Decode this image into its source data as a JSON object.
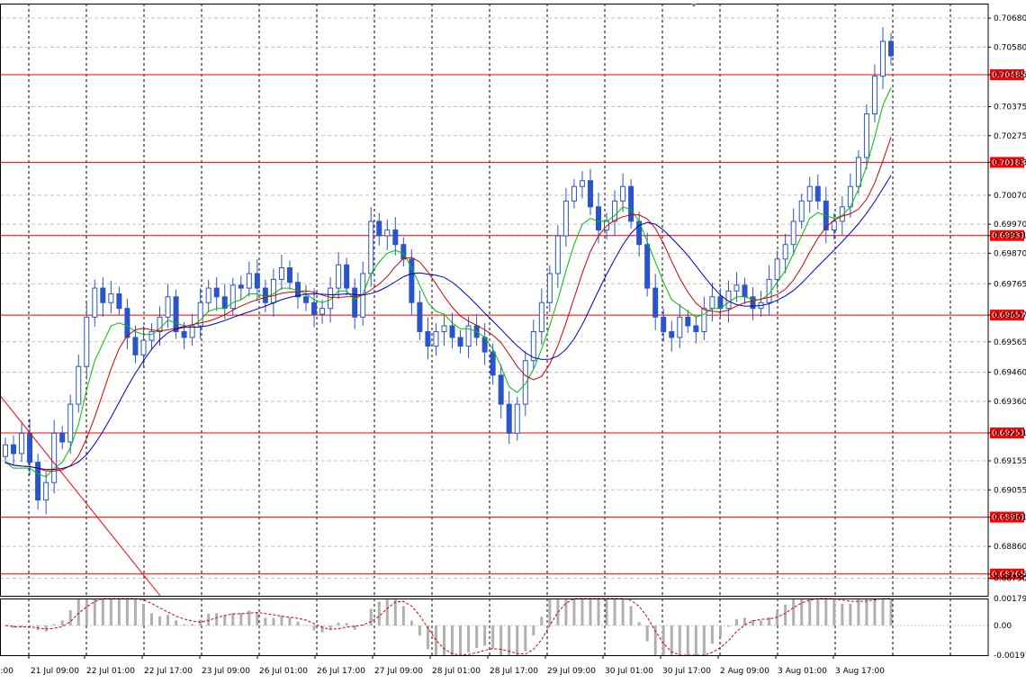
{
  "colors": {
    "background": "#ffffff",
    "grid": "#c0c0c0",
    "candle": "#2a55c8",
    "ma_fast": "#00c000",
    "ma_mid": "#d00000",
    "ma_slow": "#0000c0",
    "hline": "#ff0000",
    "label_bg": "#ff0000",
    "label_text": "#ffffff",
    "osc_hist": "#b0b0b0",
    "osc_signal": "#d00000"
  },
  "chart_data": [
    {
      "type": "candlestick",
      "ylim": [
        0.6869,
        0.7073
      ],
      "price_ticks": [
        "0.70680",
        "0.70580",
        "0.70485",
        "0.70375",
        "0.70275",
        "0.70183",
        "0.70070",
        "0.69970",
        "0.69931",
        "0.69870",
        "0.69765",
        "0.69657",
        "0.69565",
        "0.69460",
        "0.69360",
        "0.69251",
        "0.69155",
        "0.69055",
        "0.68961",
        "0.68860",
        "0.68765",
        "0.68750"
      ],
      "x_labels": [
        "21 Jul 09:00",
        "22 Jul 01:00",
        "22 Jul 17:00",
        "23 Jul 09:00",
        "26 Jul 01:00",
        "26 Jul 17:00",
        "27 Jul 09:00",
        "28 Jul 01:00",
        "28 Jul 17:00",
        "29 Jul 09:00",
        "30 Jul 01:00",
        "30 Jul 17:00",
        "2 Aug 09:00",
        "3 Aug 01:00",
        "3 Aug 17:00"
      ],
      "x_label_left_partial": "l:00",
      "horizontal_levels": [
        "0.70485",
        "0.70183",
        "0.69931",
        "0.69657",
        "0.69251",
        "0.68961",
        "0.68765"
      ],
      "close_series": [
        0.6921,
        0.6918,
        0.6925,
        0.6915,
        0.6902,
        0.6908,
        0.6925,
        0.6922,
        0.6935,
        0.6948,
        0.6965,
        0.6975,
        0.697,
        0.6973,
        0.6968,
        0.6958,
        0.6952,
        0.6957,
        0.696,
        0.6965,
        0.6972,
        0.696,
        0.6958,
        0.6962,
        0.697,
        0.6975,
        0.6972,
        0.6968,
        0.6976,
        0.6975,
        0.698,
        0.6975,
        0.697,
        0.6978,
        0.6982,
        0.6977,
        0.6972,
        0.697,
        0.6966,
        0.6968,
        0.6975,
        0.6983,
        0.6975,
        0.6965,
        0.698,
        0.6998,
        0.6993,
        0.6995,
        0.699,
        0.6985,
        0.697,
        0.696,
        0.6955,
        0.696,
        0.6962,
        0.6958,
        0.6955,
        0.6962,
        0.6958,
        0.6953,
        0.6945,
        0.6935,
        0.6925,
        0.6935,
        0.695,
        0.696,
        0.697,
        0.698,
        0.6993,
        0.7005,
        0.701,
        0.7012,
        0.7003,
        0.6995,
        0.6998,
        0.7005,
        0.701,
        0.6998,
        0.699,
        0.6975,
        0.6965,
        0.696,
        0.6958,
        0.6965,
        0.6962,
        0.696,
        0.6968,
        0.6972,
        0.6968,
        0.6974,
        0.6976,
        0.6972,
        0.6968,
        0.697,
        0.6978,
        0.6985,
        0.699,
        0.6998,
        0.7005,
        0.701,
        0.7005,
        0.6995,
        0.6998,
        0.7003,
        0.701,
        0.702,
        0.7035,
        0.7048,
        0.706,
        0.7055
      ],
      "ma_fast_values": [
        0.6915,
        0.6913,
        0.6913,
        0.6913,
        0.6911,
        0.691,
        0.6913,
        0.6915,
        0.692,
        0.6928,
        0.694,
        0.695,
        0.6956,
        0.6962,
        0.6963,
        0.6962,
        0.696,
        0.6959,
        0.6959,
        0.6961,
        0.6964,
        0.6963,
        0.6962,
        0.6962,
        0.6964,
        0.6967,
        0.6968,
        0.6968,
        0.697,
        0.6971,
        0.6973,
        0.6973,
        0.6972,
        0.6973,
        0.6975,
        0.6975,
        0.6974,
        0.6973,
        0.6971,
        0.697,
        0.6971,
        0.6974,
        0.6974,
        0.6971,
        0.6973,
        0.698,
        0.6984,
        0.6987,
        0.6988,
        0.6987,
        0.6982,
        0.6976,
        0.697,
        0.6967,
        0.6966,
        0.6963,
        0.6961,
        0.6961,
        0.696,
        0.6958,
        0.6954,
        0.6948,
        0.6941,
        0.6939,
        0.6942,
        0.6947,
        0.6954,
        0.6962,
        0.6971,
        0.6981,
        0.699,
        0.6997,
        0.6999,
        0.6998,
        0.6998,
        0.7,
        0.7003,
        0.7002,
        0.6998,
        0.6991,
        0.6984,
        0.6977,
        0.6971,
        0.6969,
        0.6967,
        0.6965,
        0.6966,
        0.6968,
        0.6968,
        0.697,
        0.6972,
        0.6972,
        0.6971,
        0.6971,
        0.6973,
        0.6977,
        0.6981,
        0.6987,
        0.6993,
        0.6999,
        0.7001,
        0.7,
        0.6999,
        0.7,
        0.7003,
        0.7009,
        0.7017,
        0.7027,
        0.7038,
        0.7044
      ]
    },
    {
      "type": "bar",
      "title": "",
      "ylim": [
        -0.00197,
        0.00179
      ],
      "y_ticks": [
        "0.001791",
        "0.00",
        "-0.00197"
      ]
    }
  ]
}
